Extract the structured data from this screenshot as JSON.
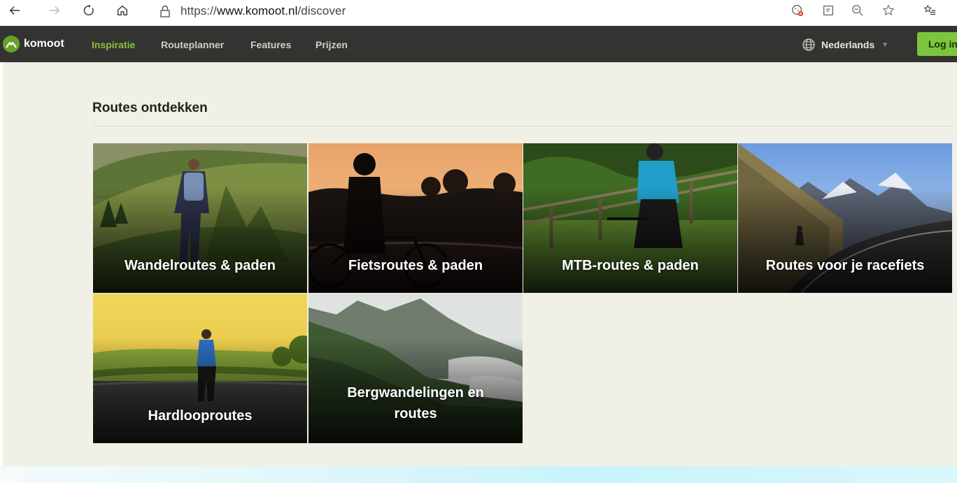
{
  "browser": {
    "url_prefix": "https://",
    "url_host": "www.komoot.nl",
    "url_path": "/discover"
  },
  "nav": {
    "brand": "komoot",
    "links": [
      "Inspiratie",
      "Routeplanner",
      "Features",
      "Prijzen"
    ],
    "active_link": "Inspiratie",
    "language": "Nederlands",
    "login": "Log in"
  },
  "section": {
    "title": "Routes ontdekken"
  },
  "tiles": [
    {
      "label": "Wandelroutes & paden"
    },
    {
      "label": "Fietsroutes & paden"
    },
    {
      "label": "MTB-routes & paden"
    },
    {
      "label": "Routes voor je racefiets"
    },
    {
      "label": "Hardlooproutes"
    },
    {
      "label": "Bergwandelingen en routes"
    }
  ],
  "colors": {
    "nav_bg": "#333431",
    "active_green": "#89c23a",
    "login_green": "#7cc63e",
    "page_bg": "#f1f0e6"
  }
}
